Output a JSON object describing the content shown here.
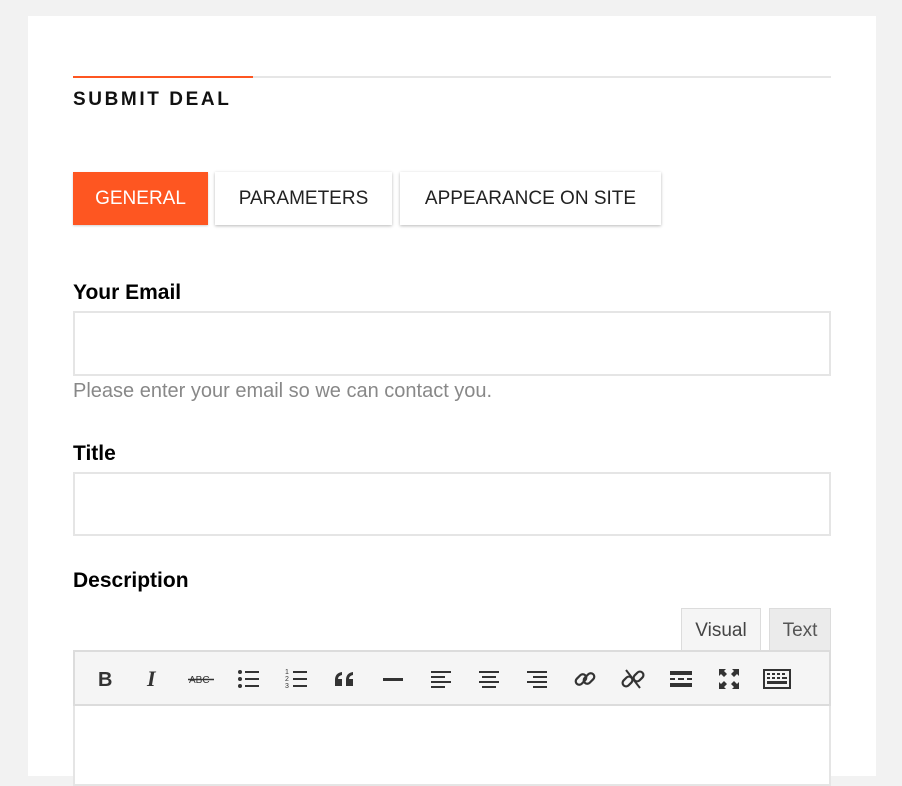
{
  "header": {
    "title": "SUBMIT DEAL"
  },
  "tabs": [
    {
      "label": "GENERAL",
      "active": true
    },
    {
      "label": "PARAMETERS",
      "active": false
    },
    {
      "label": "APPEARANCE ON SITE",
      "active": false
    }
  ],
  "form": {
    "email": {
      "label": "Your Email",
      "value": "",
      "hint": "Please enter your email so we can contact you."
    },
    "title": {
      "label": "Title",
      "value": ""
    },
    "description": {
      "label": "Description"
    }
  },
  "editor": {
    "tabs": {
      "visual": "Visual",
      "text": "Text"
    },
    "toolbar_icons": [
      "bold-icon",
      "italic-icon",
      "strikethrough-icon",
      "bullet-list-icon",
      "numbered-list-icon",
      "blockquote-icon",
      "horizontal-rule-icon",
      "align-left-icon",
      "align-center-icon",
      "align-right-icon",
      "link-icon",
      "unlink-icon",
      "read-more-icon",
      "fullscreen-icon",
      "toolbar-toggle-icon"
    ]
  },
  "colors": {
    "accent": "#fe5621",
    "icon": "#333333",
    "background": "#f2f2f2"
  }
}
